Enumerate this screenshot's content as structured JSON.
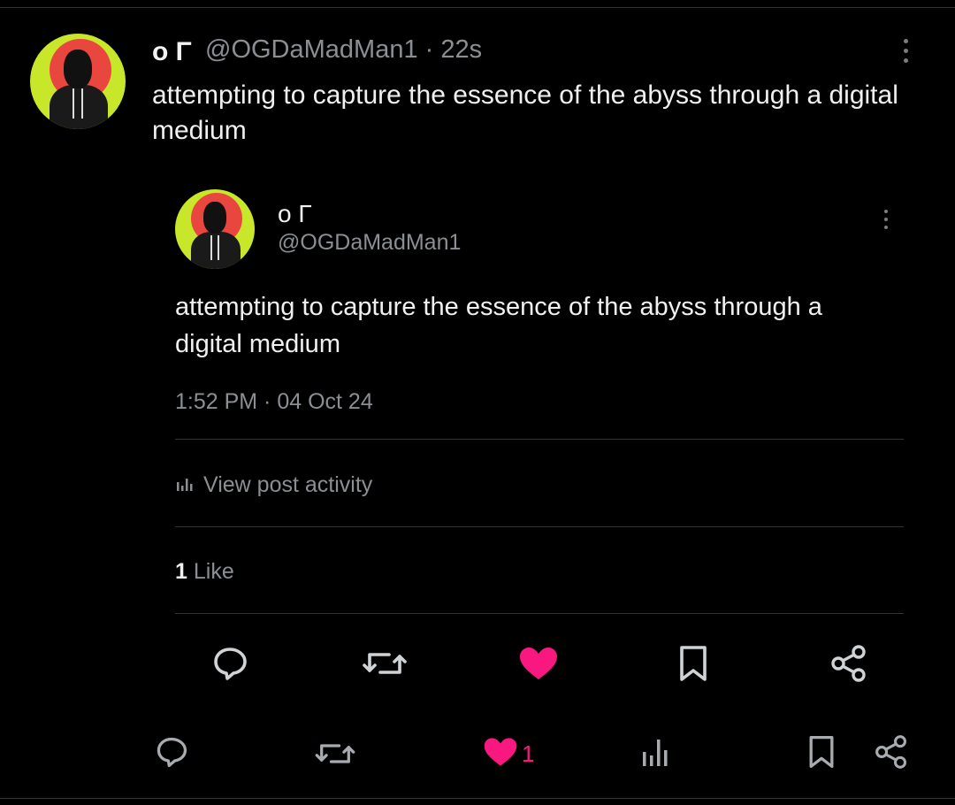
{
  "outer_post": {
    "display_name": "ο Γ",
    "handle": "@OGDaMadMan1",
    "separator": "·",
    "time_ago": "22s",
    "text": "attempting to capture the essence of the abyss through a digital medium"
  },
  "quoted_post": {
    "display_name": "ο Γ",
    "handle": "@OGDaMadMan1",
    "text": "attempting to capture the essence of the abyss through a digital medium",
    "timestamp": "1:52 PM · 04 Oct 24",
    "view_activity_label": "View post activity",
    "likes_count": "1",
    "likes_label": "Like"
  },
  "outer_actions": {
    "like_count": "1"
  },
  "colors": {
    "accent_pink": "#f91880",
    "background": "#000000",
    "muted_text": "#8b8f94",
    "divider": "#2f3336"
  },
  "icons": [
    "reply-icon",
    "repost-icon",
    "like-icon",
    "bookmark-icon",
    "share-icon",
    "views-icon",
    "more-icon"
  ]
}
